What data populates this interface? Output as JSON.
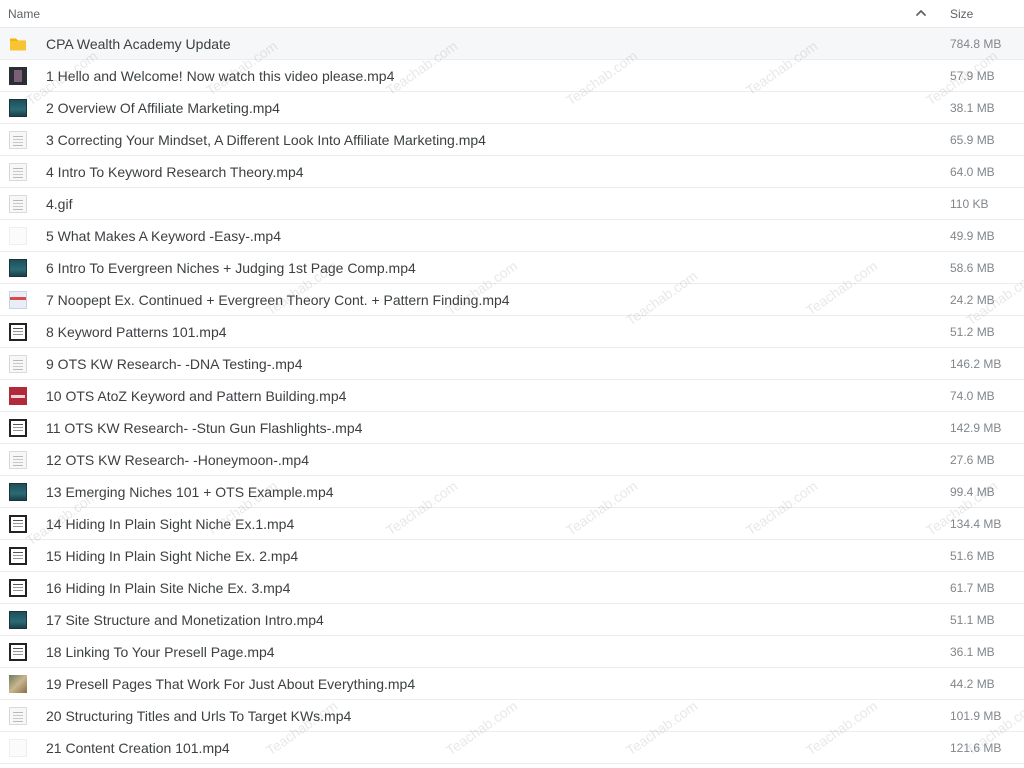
{
  "header": {
    "name_label": "Name",
    "size_label": "Size",
    "sort_icon": "chevron-up-icon"
  },
  "files": [
    {
      "name": "CPA Wealth Academy Update",
      "size": "784.8 MB",
      "thumb": "folder"
    },
    {
      "name": "1 Hello and Welcome! Now watch this video please.mp4",
      "size": "57.9 MB",
      "thumb": "dark"
    },
    {
      "name": "2 Overview Of Affiliate Marketing.mp4",
      "size": "38.1 MB",
      "thumb": "teal"
    },
    {
      "name": "3 Correcting Your Mindset, A Different Look Into Affiliate Marketing.mp4",
      "size": "65.9 MB",
      "thumb": "doc"
    },
    {
      "name": "4 Intro To Keyword Research Theory.mp4",
      "size": "64.0 MB",
      "thumb": "doc"
    },
    {
      "name": "4.gif",
      "size": "110 KB",
      "thumb": "doc"
    },
    {
      "name": "5 What Makes A Keyword -Easy-.mp4",
      "size": "49.9 MB",
      "thumb": "blank"
    },
    {
      "name": "6 Intro To Evergreen Niches + Judging 1st Page Comp.mp4",
      "size": "58.6 MB",
      "thumb": "teal"
    },
    {
      "name": "7 Noopept Ex. Continued + Evergreen Theory Cont. + Pattern Finding.mp4",
      "size": "24.2 MB",
      "thumb": "stripe"
    },
    {
      "name": "8 Keyword Patterns 101.mp4",
      "size": "51.2 MB",
      "thumb": "window"
    },
    {
      "name": "9 OTS KW Research- -DNA Testing-.mp4",
      "size": "146.2 MB",
      "thumb": "doc"
    },
    {
      "name": "10 OTS AtoZ Keyword and Pattern Building.mp4",
      "size": "74.0 MB",
      "thumb": "red"
    },
    {
      "name": "11 OTS KW Research- -Stun Gun Flashlights-.mp4",
      "size": "142.9 MB",
      "thumb": "window"
    },
    {
      "name": "12 OTS KW Research- -Honeymoon-.mp4",
      "size": "27.6 MB",
      "thumb": "doc"
    },
    {
      "name": "13 Emerging Niches 101 + OTS Example.mp4",
      "size": "99.4 MB",
      "thumb": "teal"
    },
    {
      "name": "14 Hiding In Plain Sight Niche Ex.1.mp4",
      "size": "134.4 MB",
      "thumb": "window"
    },
    {
      "name": "15 Hiding In Plain Sight Niche Ex. 2.mp4",
      "size": "51.6 MB",
      "thumb": "window"
    },
    {
      "name": "16 Hiding In Plain Site Niche Ex. 3.mp4",
      "size": "61.7 MB",
      "thumb": "window"
    },
    {
      "name": "17 Site Structure and Monetization Intro.mp4",
      "size": "51.1 MB",
      "thumb": "teal"
    },
    {
      "name": "18 Linking To Your Presell Page.mp4",
      "size": "36.1 MB",
      "thumb": "window"
    },
    {
      "name": "19 Presell Pages That Work For Just About Everything.mp4",
      "size": "44.2 MB",
      "thumb": "photo"
    },
    {
      "name": "20 Structuring Titles and Urls To Target KWs.mp4",
      "size": "101.9 MB",
      "thumb": "doc"
    },
    {
      "name": "21 Content Creation 101.mp4",
      "size": "121.6 MB",
      "thumb": "blank"
    }
  ],
  "watermark_text": "Teachab.com",
  "colors": {
    "folder": "#f5b400",
    "accent": "#1a73e8"
  }
}
